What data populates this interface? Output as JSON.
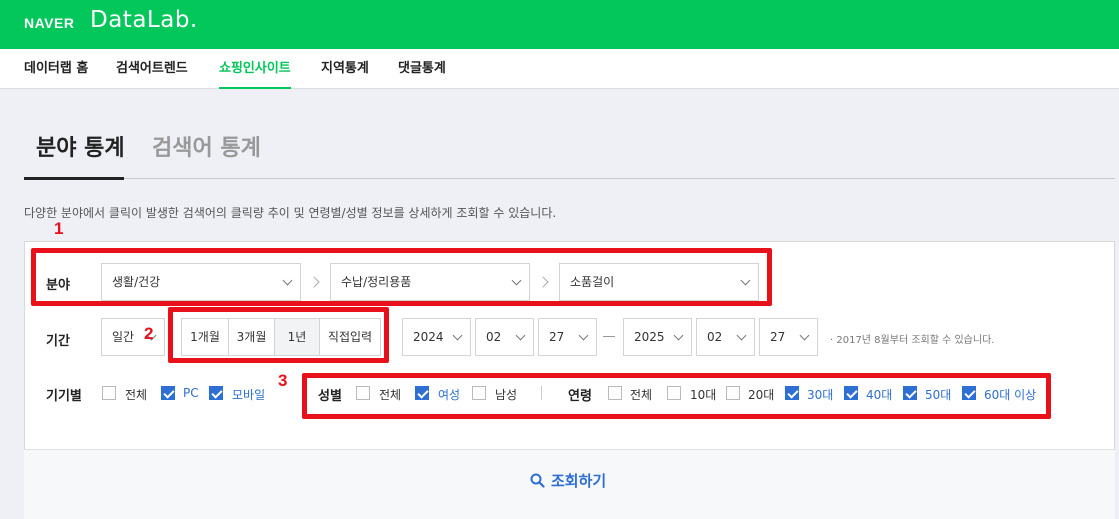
{
  "header": {
    "brand": "NAVER",
    "product": "DataLab."
  },
  "nav": {
    "items": [
      {
        "label": "데이터랩 홈"
      },
      {
        "label": "검색어트렌드"
      },
      {
        "label": "쇼핑인사이트"
      },
      {
        "label": "지역통계"
      },
      {
        "label": "댓글통계"
      }
    ],
    "active": "쇼핑인사이트"
  },
  "section_tabs": {
    "active": "분야 통계",
    "inactive": "검색어 통계"
  },
  "description": "다양한 분야에서 클릭이 발생한 검색어의 클릭량 추이 및 연령별/성별 정보를 상세하게 조회할 수 있습니다.",
  "category": {
    "label": "분야",
    "levels": [
      "생활/건강",
      "수납/정리용품",
      "소품걸이"
    ]
  },
  "period": {
    "label": "기간",
    "granularity": "일간",
    "quick_buttons": [
      "1개월",
      "3개월",
      "1년",
      "직접입력"
    ],
    "selected_quick": "1년",
    "start": {
      "year": "2024",
      "month": "02",
      "day": "27"
    },
    "end": {
      "year": "2025",
      "month": "02",
      "day": "27"
    },
    "note": "· 2017년 8월부터 조회할 수 있습니다."
  },
  "device": {
    "label": "기기별",
    "options": [
      {
        "label": "전체",
        "checked": false
      },
      {
        "label": "PC",
        "checked": true
      },
      {
        "label": "모바일",
        "checked": true
      }
    ]
  },
  "gender": {
    "label": "성별",
    "options": [
      {
        "label": "전체",
        "checked": false
      },
      {
        "label": "여성",
        "checked": true
      },
      {
        "label": "남성",
        "checked": false
      }
    ]
  },
  "age": {
    "label": "연령",
    "options": [
      {
        "label": "전체",
        "checked": false
      },
      {
        "label": "10대",
        "checked": false
      },
      {
        "label": "20대",
        "checked": false
      },
      {
        "label": "30대",
        "checked": true
      },
      {
        "label": "40대",
        "checked": true
      },
      {
        "label": "50대",
        "checked": true
      },
      {
        "label": "60대 이상",
        "checked": true
      }
    ]
  },
  "search_button": "조회하기",
  "annotations": {
    "badge1": "1",
    "badge2": "2",
    "badge3": "3"
  },
  "colors": {
    "brand_green": "#03c75a",
    "accent_blue": "#2d6fd2",
    "annotation_red": "#e8101a"
  }
}
